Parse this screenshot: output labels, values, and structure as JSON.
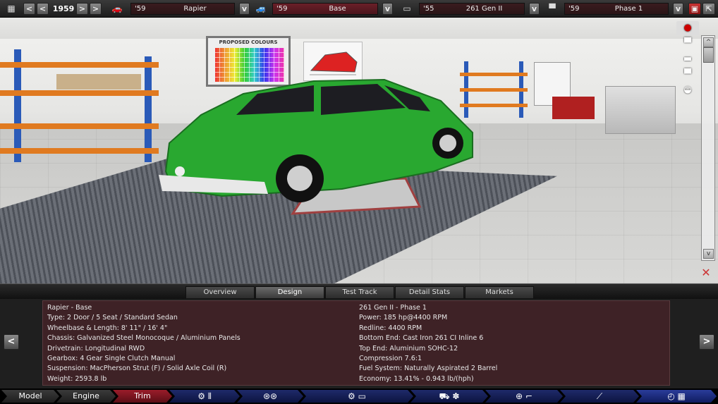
{
  "topbar": {
    "calendar_icon": "calendar-icon",
    "year": "1959",
    "prev_first": "<",
    "prev": "<",
    "next": ">",
    "next_last": ">",
    "model": {
      "year": "'59",
      "name": "Rapier"
    },
    "trim": {
      "year": "'59",
      "name": "Base"
    },
    "engine": {
      "year": "'55",
      "name": "261 Gen II"
    },
    "engine_variant": {
      "year": "'59",
      "name": "Phase 1"
    },
    "dropdown": "v"
  },
  "scene": {
    "poster_title": "PROPOSED COLOURS",
    "scroll_up": "^",
    "scroll_down": "v"
  },
  "tabs": [
    "Overview",
    "Design",
    "Test Track",
    "Detail Stats",
    "Markets"
  ],
  "active_tab": "Design",
  "car_info": [
    "Rapier - Base",
    "Type: 2 Door / 5 Seat / Standard Sedan",
    "Wheelbase & Length: 8' 11\" / 16' 4\"",
    "Chassis: Galvanized Steel Monocoque / Aluminium Panels",
    "Drivetrain: Longitudinal RWD",
    "Gearbox: 4 Gear Single Clutch Manual",
    "Suspension: MacPherson Strut (F) / Solid Axle Coil (R)",
    "Weight: 2593.8 lb"
  ],
  "engine_info": [
    "261 Gen II - Phase 1",
    "Power: 185 hp@4400 RPM",
    "Redline: 4400 RPM",
    "Bottom End: Cast Iron 261 CI Inline 6",
    "Top End: Aluminium SOHC-12",
    "Compression 7.6:1",
    "Fuel System: Naturally Aspirated 2 Barrel",
    "Economy: 13.41% - 0.943 lb/(hph)"
  ],
  "nav": {
    "prev": "<",
    "next": ">"
  },
  "bottom": {
    "model": "Model",
    "engine": "Engine",
    "trim": "Trim"
  }
}
